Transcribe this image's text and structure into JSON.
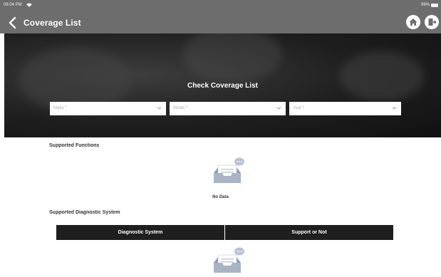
{
  "status_bar": {
    "time": "06:04 PM",
    "battery": "99%"
  },
  "app_bar": {
    "title": "Coverage List",
    "back_icon": "chevron-left-icon",
    "home_icon": "home-icon",
    "exit_icon": "exit-icon"
  },
  "selector": {
    "title": "Check Coverage List",
    "make_placeholder": "Make *",
    "model_placeholder": "Model *",
    "year_placeholder": "Year *"
  },
  "supported_functions": {
    "heading": "Supported Functions",
    "empty_text": "No Data"
  },
  "diagnostic": {
    "heading": "Supported Diagnostic System",
    "columns": [
      "Diagnostic System",
      "Support or Not"
    ]
  },
  "colors": {
    "app_bar": "#6d6d6d",
    "table_header": "#1f1f1f",
    "illustration": "#a9b4c6"
  }
}
